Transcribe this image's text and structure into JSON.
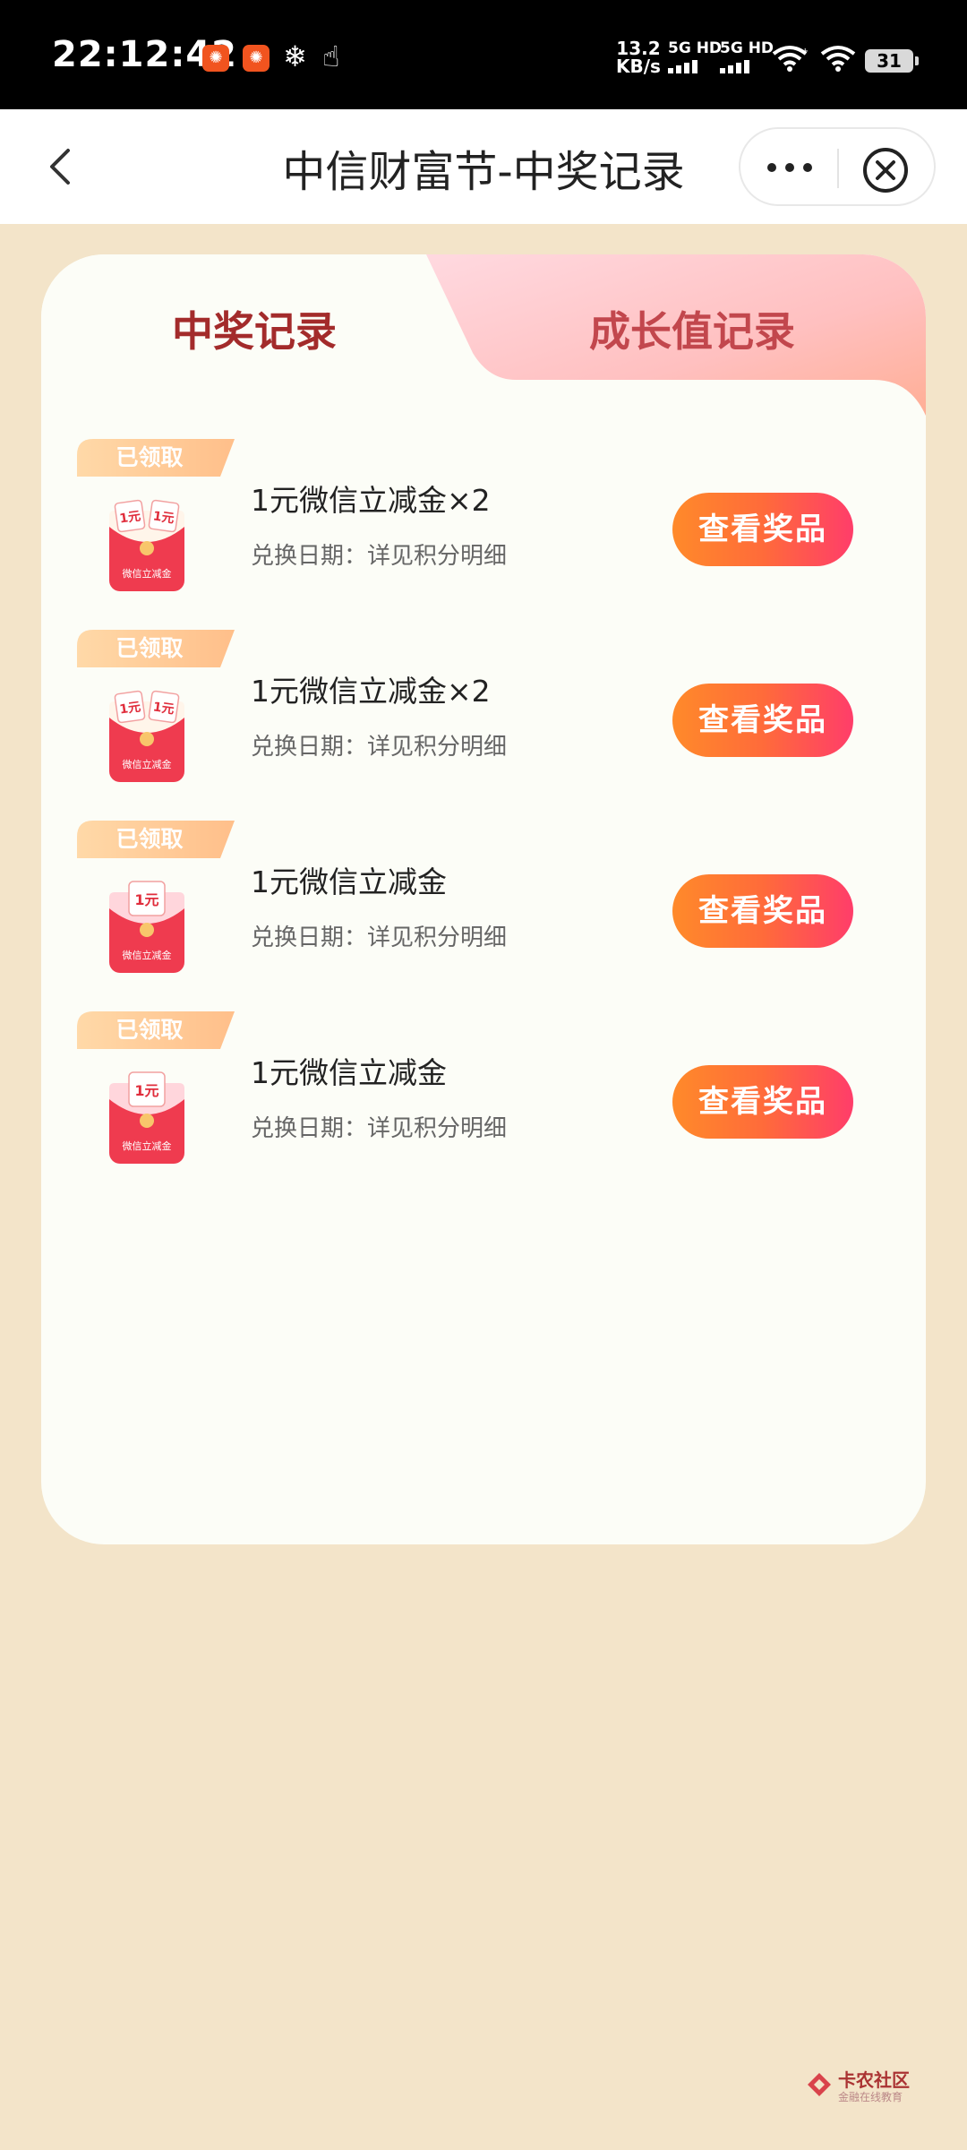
{
  "status_bar": {
    "time": "22:12:42",
    "speed_value": "13.2",
    "speed_unit": "KB/s",
    "sim1_label": "5G HD",
    "sim2_label": "5G HD",
    "battery": "31"
  },
  "nav": {
    "title": "中信财富节-中奖记录"
  },
  "tabs": [
    {
      "label": "中奖记录",
      "active": true
    },
    {
      "label": "成长值记录",
      "active": false
    }
  ],
  "records": [
    {
      "status": "已领取",
      "title": "1元微信立减金×2",
      "subtitle": "兑换日期：详见积分明细",
      "button": "查看奖品",
      "thumb_top": "1元",
      "thumb_label": "微信立减金",
      "double": true
    },
    {
      "status": "已领取",
      "title": "1元微信立减金×2",
      "subtitle": "兑换日期：详见积分明细",
      "button": "查看奖品",
      "thumb_top": "1元",
      "thumb_label": "微信立减金",
      "double": true
    },
    {
      "status": "已领取",
      "title": "1元微信立减金",
      "subtitle": "兑换日期：详见积分明细",
      "button": "查看奖品",
      "thumb_top": "1元",
      "thumb_label": "微信立减金",
      "double": false
    },
    {
      "status": "已领取",
      "title": "1元微信立减金",
      "subtitle": "兑换日期：详见积分明细",
      "button": "查看奖品",
      "thumb_top": "1元",
      "thumb_label": "微信立减金",
      "double": false
    }
  ],
  "watermark": {
    "name": "卡农社区",
    "sub": "金融在线教育"
  },
  "colors": {
    "page_bg": "#f3e4c9",
    "card_bg": "#fcfdf7",
    "active_tab": "#a32b2b",
    "inactive_tab": "#c2474d",
    "button_start": "#ff8a2a",
    "button_end": "#ff3d6a",
    "badge": "#ffc58a"
  }
}
